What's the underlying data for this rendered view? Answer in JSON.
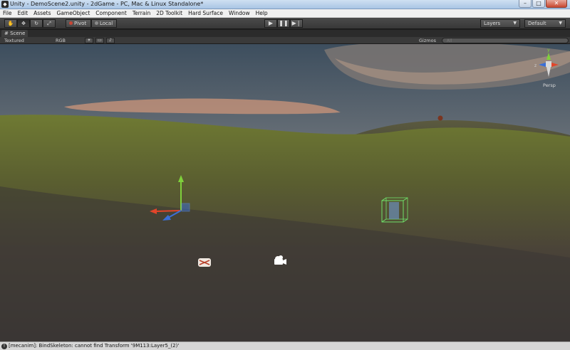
{
  "window": {
    "title": "Unity - DemoScene2.unity - 2dGame - PC, Mac & Linux Standalone*"
  },
  "menu": [
    "File",
    "Edit",
    "Assets",
    "GameObject",
    "Component",
    "Terrain",
    "2D Toolkit",
    "Hard Surface",
    "Window",
    "Help"
  ],
  "toolbar": {
    "pivot_label": "Pivot",
    "local_label": "Local",
    "layers_label": "Layers",
    "layout_label": "Default",
    "tools": [
      "hand-tool-icon",
      "move-tool-icon",
      "rotate-tool-icon",
      "scale-tool-icon"
    ],
    "playback": [
      "play-icon",
      "pause-icon",
      "step-icon"
    ]
  },
  "scene": {
    "tab_label": "Scene",
    "draw_mode": "Textured",
    "render_mode": "RGB",
    "gizmos_label": "Gizmos",
    "search_placeholder": "All",
    "projection_label": "Persp"
  },
  "status": {
    "message": "[mecanim]: BindSkeleton: cannot find Transform '9M113:Layer5_(2)'"
  },
  "colors": {
    "axis_x": "#e2452a",
    "axis_y": "#7fd13b",
    "axis_z": "#3a6fd8",
    "selection_box": "#6fe06a"
  }
}
